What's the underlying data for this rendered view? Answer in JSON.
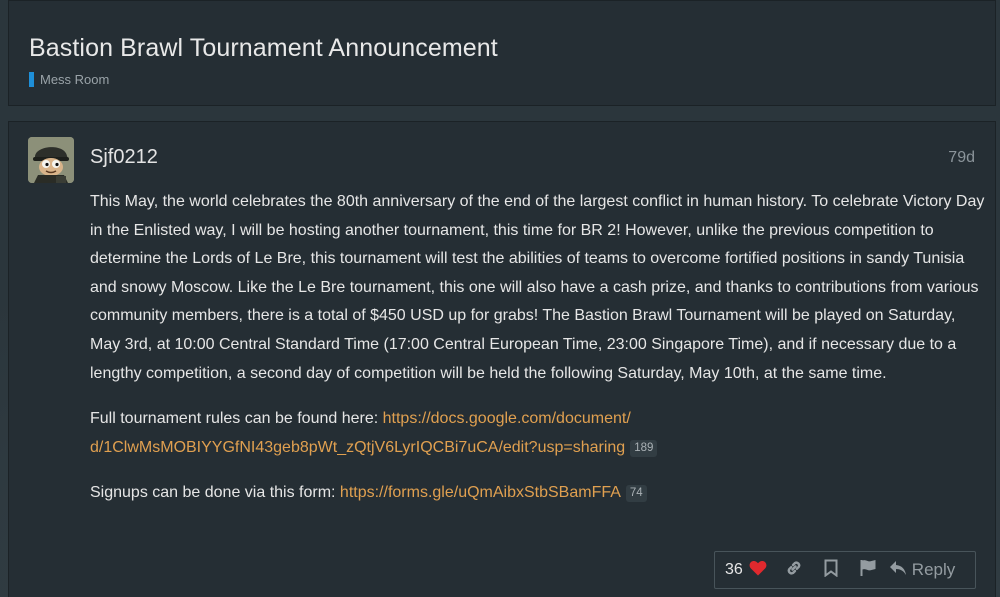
{
  "topic": {
    "title": "Bastion Brawl Tournament Announcement",
    "category": "Mess Room",
    "category_color": "#1e8fd8"
  },
  "post": {
    "username": "Sjf0212",
    "date": "79d",
    "avatar_icon": "soldier-avatar-icon",
    "paragraph1": "This May, the world celebrates the 80th anniversary of the end of the largest conflict in human history. To celebrate Victory Day in the Enlisted way, I will be hosting another tournament, this time for BR 2! However, unlike the previous competition to determine the Lords of Le Bre, this tournament will test the abilities of teams to overcome fortified positions in sandy Tunisia and snowy Moscow. Like the Le Bre tournament, this one will also have a cash prize, and thanks to contributions from various community members, there is a total of $450 USD up for grabs! The Bastion Brawl Tournament will be played on Saturday, May 3rd, at 10:00 Central Standard Time (17:00 Central European Time, 23:00 Singapore Time), and if necessary due to a lengthy competition, a second day of competition will be held the following Saturday, May 10th, at the same time.",
    "rules_prefix": "Full tournament rules can be found here: ",
    "rules_link_line1": "https://docs.google.com/document/",
    "rules_link_line2": "d/1ClwMsMOBIYYGfNI43geb8pWt_zQtjV6LyrIQCBi7uCA/edit?usp=sharing",
    "rules_clicks": "189",
    "signup_prefix": "Signups can be done via this form: ",
    "signup_link": "https://forms.gle/uQmAibxStbSBamFFA",
    "signup_clicks": "74"
  },
  "actions": {
    "like_count": "36",
    "like_icon": "heart-icon",
    "link_icon": "link-icon",
    "bookmark_icon": "bookmark-icon",
    "flag_icon": "flag-icon",
    "reply_icon": "reply-arrow-icon",
    "reply_label": "Reply"
  },
  "colors": {
    "link": "#e0a050",
    "heart": "#e0292e",
    "muted": "#949ca1"
  }
}
